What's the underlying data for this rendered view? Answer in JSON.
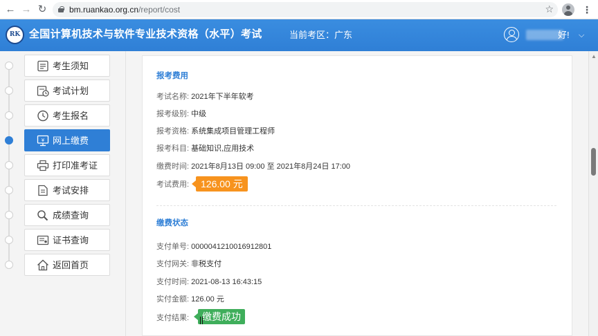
{
  "browser": {
    "url_host": "bm.ruankao.org.cn",
    "url_path": "/report/cost"
  },
  "header": {
    "title": "全国计算机技术与软件专业技术资格（水平）考试",
    "region_label": "当前考区：",
    "region": "广东",
    "greeting": "好!"
  },
  "sidebar": {
    "items": [
      {
        "label": "考生须知",
        "icon": "notice-icon"
      },
      {
        "label": "考试计划",
        "icon": "calendar-clock-icon"
      },
      {
        "label": "考生报名",
        "icon": "clock-icon"
      },
      {
        "label": "网上缴费",
        "icon": "monitor-icon",
        "active": true
      },
      {
        "label": "打印准考证",
        "icon": "printer-icon"
      },
      {
        "label": "考试安排",
        "icon": "document-icon"
      },
      {
        "label": "成绩查询",
        "icon": "search-icon"
      },
      {
        "label": "证书查询",
        "icon": "certificate-icon"
      },
      {
        "label": "返回首页",
        "icon": "home-icon"
      }
    ]
  },
  "fee_section": {
    "title": "报考费用",
    "exam_name_label": "考试名称:",
    "exam_name": "2021年下半年软考",
    "level_label": "报考级别:",
    "level": "中级",
    "qualification_label": "报考资格:",
    "qualification": "系统集成项目管理工程师",
    "subjects_label": "报考科目:",
    "subjects": "基础知识,应用技术",
    "pay_period_label": "缴费时间:",
    "pay_period": "2021年8月13日 09:00 至 2021年8月24日 17:00",
    "fee_label": "考试费用:",
    "fee": "126.00 元"
  },
  "status_section": {
    "title": "缴费状态",
    "order_no_label": "支付单号:",
    "order_no": "0000041210016912801",
    "gateway_label": "支付网关:",
    "gateway": "非税支付",
    "pay_time_label": "支付时间:",
    "pay_time": "2021-08-13 16:43:15",
    "amount_label": "实付金额:",
    "amount": "126.00 元",
    "result_label": "支付结果:",
    "result": "缴费成功"
  },
  "colors": {
    "brand_blue": "#2f7fd6",
    "fee_orange": "#f7931e",
    "success_green": "#3fae5b"
  }
}
